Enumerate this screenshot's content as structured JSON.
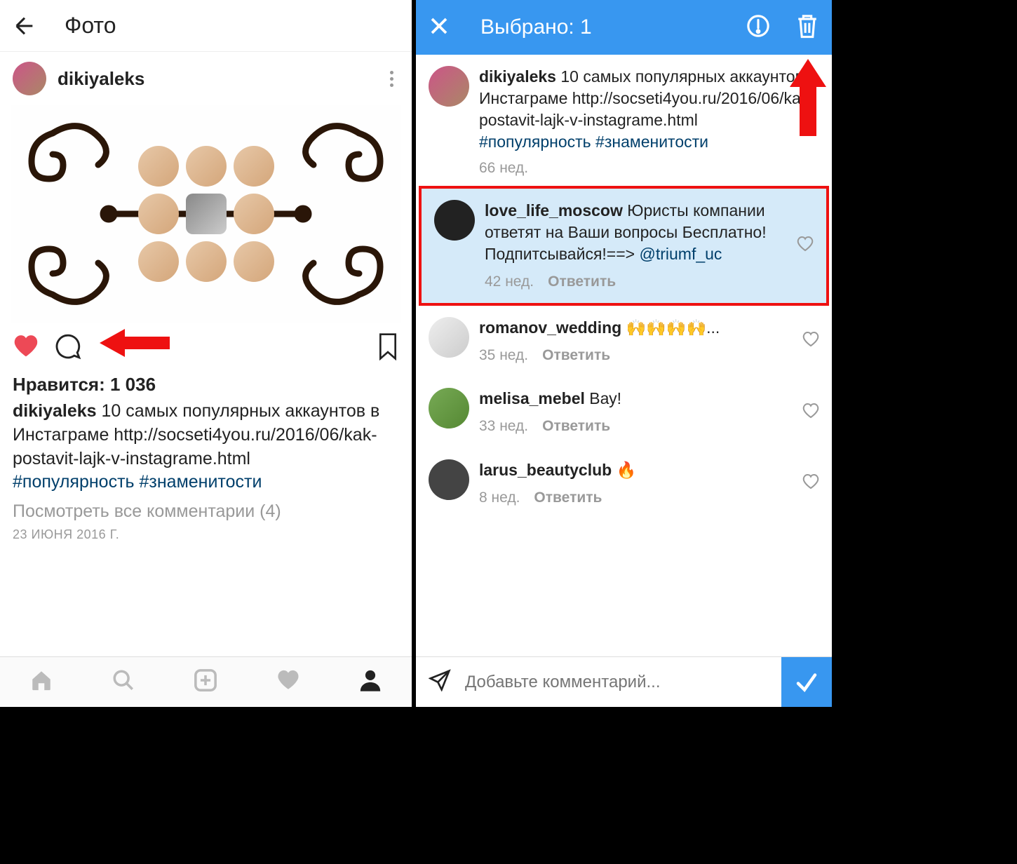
{
  "left": {
    "header_title": "Фото",
    "username": "dikiyaleks",
    "likes_label": "Нравится: 1 036",
    "caption_user": "dikiyaleks",
    "caption_text": " 10 самых популярных аккаунтов в Инстаграме http://socseti4you.ru/2016/06/kak-postavit-lajk-v-instagrame.html",
    "hashtags": "#популярность #знаменитости",
    "view_comments": "Посмотреть все комментарии (4)",
    "date": "23 ИЮНЯ 2016 Г."
  },
  "right": {
    "header_title": "Выбрано: 1",
    "post": {
      "user": "dikiyaleks",
      "text": " 10 самых популярных аккаунтов в Инстаграме http://socseti4you.ru/2016/06/kak-postavit-lajk-v-instagrame.html",
      "hashtags": "#популярность #знаменитости",
      "time": "66 нед."
    },
    "comments": [
      {
        "user": "love_life_moscow",
        "text": " Юристы компании ответят на Ваши вопросы Бесплатно! Подпитсывайся!==> ",
        "mention": "@triumf_uc",
        "time": "42 нед.",
        "reply": "Ответить",
        "selected": true
      },
      {
        "user": "romanov_wedding",
        "text": " 🙌🙌🙌🙌...",
        "time": "35 нед.",
        "reply": "Ответить"
      },
      {
        "user": "melisa_mebel",
        "text": " Вау!",
        "time": "33 нед.",
        "reply": "Ответить"
      },
      {
        "user": "larus_beautyclub",
        "text": " 🔥",
        "time": "8 нед.",
        "reply": "Ответить"
      }
    ],
    "input_placeholder": "Добавьте комментарий..."
  }
}
